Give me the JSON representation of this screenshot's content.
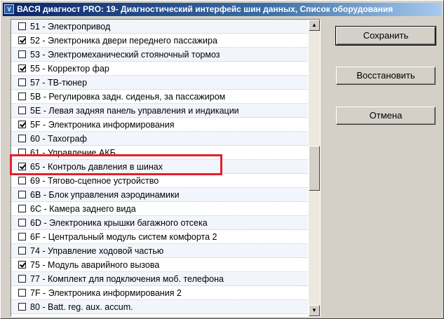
{
  "window": {
    "title": "ВАСЯ диагност PRO: 19- Диагностический интерфейс шин данных,  Список оборудования",
    "icon_name": "app-icon"
  },
  "equipment_list": {
    "items": [
      {
        "label": "51 -  Электропривод",
        "checked": false
      },
      {
        "label": "52 -  Электроника двери переднего пассажира",
        "checked": true
      },
      {
        "label": "53 -  Электромеханический стояночный тормоз",
        "checked": false
      },
      {
        "label": "55 -  Корректор фар",
        "checked": true
      },
      {
        "label": "57 -  ТВ-тюнер",
        "checked": false
      },
      {
        "label": "5B -  Регулировка задн. сиденья, за пассажиром",
        "checked": false
      },
      {
        "label": "5E -  Левая задняя панель управления и индикации",
        "checked": false
      },
      {
        "label": "5F -  Электроника информирования",
        "checked": true
      },
      {
        "label": "60 -  Тахограф",
        "checked": false
      },
      {
        "label": "61 -  Управление АКБ",
        "checked": false
      },
      {
        "label": "65 -  Контроль давления в шинах",
        "checked": true
      },
      {
        "label": "69 -  Тягово-сцепное устройство",
        "checked": false
      },
      {
        "label": "6B -  Блок управления аэродинамики",
        "checked": false
      },
      {
        "label": "6C -  Камера заднего вида",
        "checked": false
      },
      {
        "label": "6D -  Электроника крышки багажного отсека",
        "checked": false
      },
      {
        "label": "6F -  Центральный модуль систем комфорта 2",
        "checked": false
      },
      {
        "label": "74 -  Управление ходовой частью",
        "checked": false
      },
      {
        "label": "75 -  Модуль аварийного вызова",
        "checked": true
      },
      {
        "label": "77 -  Комплект для подключения моб. телефона",
        "checked": false
      },
      {
        "label": "7F -  Электроника информирования 2",
        "checked": false
      },
      {
        "label": "80 -  Batt. reg. aux. accum.",
        "checked": false
      }
    ]
  },
  "buttons": {
    "save": "Сохранить",
    "restore": "Восстановить",
    "cancel": "Отмена"
  },
  "colors": {
    "highlight": "#e4202a",
    "titlebar": "#0a246a"
  }
}
